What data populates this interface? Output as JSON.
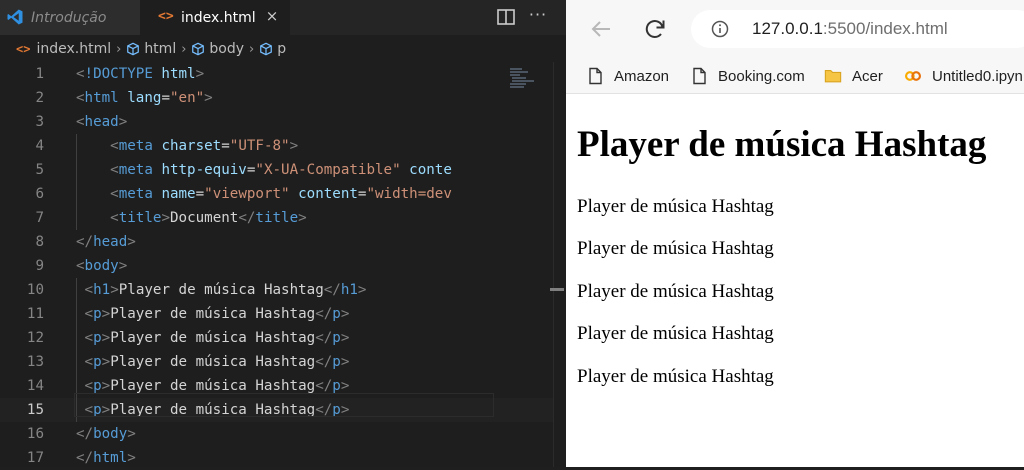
{
  "editor": {
    "tabs": [
      {
        "label": "Introdução",
        "active": false
      },
      {
        "label": "index.html",
        "active": true
      }
    ],
    "tab_file_icon": "<>",
    "tab_close_icon": "×",
    "more_actions_icon": "···",
    "breadcrumb": [
      "index.html",
      "html",
      "body",
      "p"
    ],
    "current_line": 15,
    "lines": [
      [
        [
          "b",
          "<"
        ],
        [
          "t",
          "!DOCTYPE "
        ],
        [
          "a",
          "html"
        ],
        [
          "b",
          ">"
        ]
      ],
      [
        [
          "b",
          "<"
        ],
        [
          "t",
          "html "
        ],
        [
          "a",
          "lang"
        ],
        [
          "x",
          "="
        ],
        [
          "s",
          "\"en\""
        ],
        [
          "b",
          ">"
        ]
      ],
      [
        [
          "b",
          "<"
        ],
        [
          "t",
          "head"
        ],
        [
          "b",
          ">"
        ]
      ],
      [
        [
          "x",
          "    "
        ],
        [
          "b",
          "<"
        ],
        [
          "t",
          "meta "
        ],
        [
          "a",
          "charset"
        ],
        [
          "x",
          "="
        ],
        [
          "s",
          "\"UTF-8\""
        ],
        [
          "b",
          ">"
        ]
      ],
      [
        [
          "x",
          "    "
        ],
        [
          "b",
          "<"
        ],
        [
          "t",
          "meta "
        ],
        [
          "a",
          "http-equiv"
        ],
        [
          "x",
          "="
        ],
        [
          "s",
          "\"X-UA-Compatible\""
        ],
        [
          "x",
          " "
        ],
        [
          "a",
          "conte"
        ]
      ],
      [
        [
          "x",
          "    "
        ],
        [
          "b",
          "<"
        ],
        [
          "t",
          "meta "
        ],
        [
          "a",
          "name"
        ],
        [
          "x",
          "="
        ],
        [
          "s",
          "\"viewport\""
        ],
        [
          "x",
          " "
        ],
        [
          "a",
          "content"
        ],
        [
          "x",
          "="
        ],
        [
          "s",
          "\"width=dev"
        ]
      ],
      [
        [
          "x",
          "    "
        ],
        [
          "b",
          "<"
        ],
        [
          "t",
          "title"
        ],
        [
          "b",
          ">"
        ],
        [
          "x",
          "Document"
        ],
        [
          "b",
          "</"
        ],
        [
          "t",
          "title"
        ],
        [
          "b",
          ">"
        ]
      ],
      [
        [
          "b",
          "</"
        ],
        [
          "t",
          "head"
        ],
        [
          "b",
          ">"
        ]
      ],
      [
        [
          "b",
          "<"
        ],
        [
          "t",
          "body"
        ],
        [
          "b",
          ">"
        ]
      ],
      [
        [
          "x",
          " "
        ],
        [
          "b",
          "<"
        ],
        [
          "t",
          "h1"
        ],
        [
          "b",
          ">"
        ],
        [
          "x",
          "Player de música Hashtag"
        ],
        [
          "b",
          "</"
        ],
        [
          "t",
          "h1"
        ],
        [
          "b",
          ">"
        ]
      ],
      [
        [
          "x",
          " "
        ],
        [
          "b",
          "<"
        ],
        [
          "t",
          "p"
        ],
        [
          "b",
          ">"
        ],
        [
          "x",
          "Player de música Hashtag"
        ],
        [
          "b",
          "</"
        ],
        [
          "t",
          "p"
        ],
        [
          "b",
          ">"
        ]
      ],
      [
        [
          "x",
          " "
        ],
        [
          "b",
          "<"
        ],
        [
          "t",
          "p"
        ],
        [
          "b",
          ">"
        ],
        [
          "x",
          "Player de música Hashtag"
        ],
        [
          "b",
          "</"
        ],
        [
          "t",
          "p"
        ],
        [
          "b",
          ">"
        ]
      ],
      [
        [
          "x",
          " "
        ],
        [
          "b",
          "<"
        ],
        [
          "t",
          "p"
        ],
        [
          "b",
          ">"
        ],
        [
          "x",
          "Player de música Hashtag"
        ],
        [
          "b",
          "</"
        ],
        [
          "t",
          "p"
        ],
        [
          "b",
          ">"
        ]
      ],
      [
        [
          "x",
          " "
        ],
        [
          "b",
          "<"
        ],
        [
          "t",
          "p"
        ],
        [
          "b",
          ">"
        ],
        [
          "x",
          "Player de música Hashtag"
        ],
        [
          "b",
          "</"
        ],
        [
          "t",
          "p"
        ],
        [
          "b",
          ">"
        ]
      ],
      [
        [
          "x",
          " "
        ],
        [
          "b",
          "<"
        ],
        [
          "t",
          "p"
        ],
        [
          "b",
          ">"
        ],
        [
          "x",
          "Player de música Hashtag"
        ],
        [
          "b",
          "</"
        ],
        [
          "t",
          "p"
        ],
        [
          "b",
          ">"
        ]
      ],
      [
        [
          "b",
          "</"
        ],
        [
          "t",
          "body"
        ],
        [
          "b",
          ">"
        ]
      ],
      [
        [
          "b",
          "</"
        ],
        [
          "t",
          "html"
        ],
        [
          "b",
          ">"
        ]
      ]
    ]
  },
  "browser": {
    "url_host": "127.0.0.1",
    "url_rest": ":5500/index.html",
    "bookmarks": [
      {
        "label": "Amazon",
        "icon": "page-icon"
      },
      {
        "label": "Booking.com",
        "icon": "page-icon"
      },
      {
        "label": "Acer",
        "icon": "folder-icon"
      },
      {
        "label": "Untitled0.ipyn",
        "icon": "colab-icon"
      }
    ],
    "page": {
      "h1": "Player de música Hashtag",
      "paragraphs": [
        "Player de música Hashtag",
        "Player de música Hashtag",
        "Player de música Hashtag",
        "Player de música Hashtag",
        "Player de música Hashtag"
      ]
    }
  },
  "colors": {
    "tag": "#569cd6",
    "attribute": "#9cdcfe",
    "string": "#ce9178",
    "bracket": "#808080",
    "text": "#d4d4d4",
    "html_file_icon": "#e37933",
    "breadcrumb_symbol": "#75beff"
  }
}
